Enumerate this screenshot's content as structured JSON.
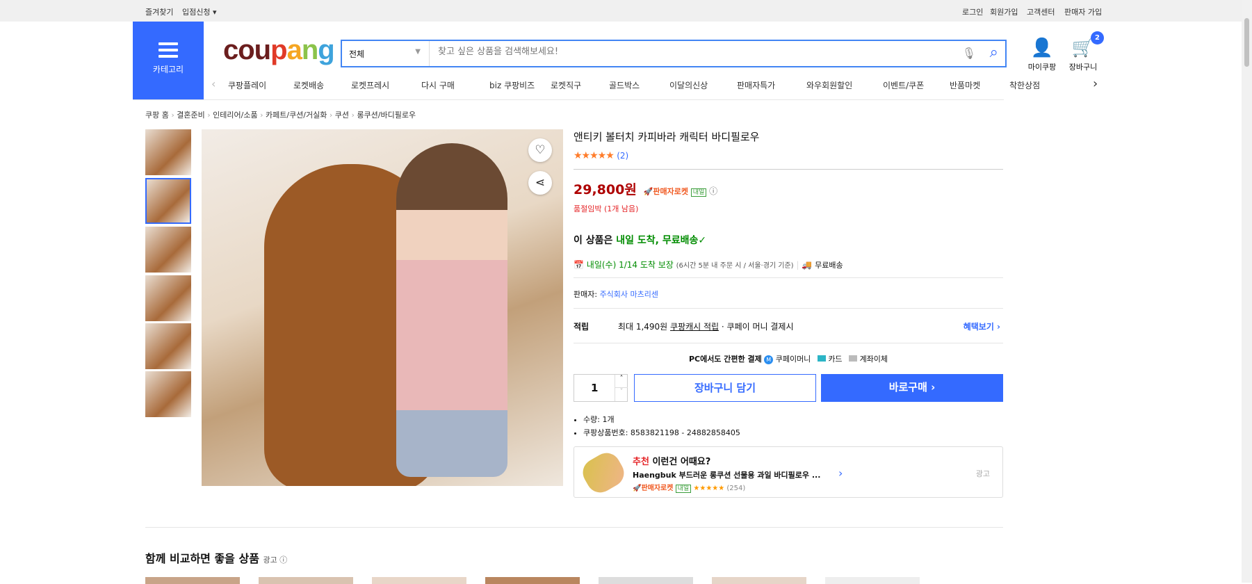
{
  "topbar": {
    "bookmark": "즐겨찾기",
    "seller_apply": "입점신청 ▾",
    "login": "로그인",
    "signup": "회원가입",
    "support": "고객센터",
    "seller_signup": "판매자 가입"
  },
  "header": {
    "category": "카테고리",
    "logo": "coupang",
    "search_category": "전체",
    "search_placeholder": "찾고 싶은 상품을 검색해보세요!",
    "my_coupang": "마이쿠팡",
    "cart": "장바구니",
    "cart_count": "2"
  },
  "nav": [
    "쿠팡플레이",
    "로켓배송",
    "로켓프레시",
    "다시 구매",
    "biz 쿠팡비즈",
    "로켓직구",
    "골드박스",
    "이달의신상",
    "판매자특가",
    "와우회원할인",
    "이벤트/쿠폰",
    "반품마켓",
    "착한상점"
  ],
  "breadcrumb": [
    "쿠팡 홈",
    "결혼준비",
    "인테리어/소품",
    "카페트/쿠션/거실화",
    "쿠션",
    "롱쿠션/바디필로우"
  ],
  "product": {
    "title": "앤티키 볼터치 카피바라 캐릭터 바디필로우",
    "rating_count": "(2)",
    "rating": 5,
    "price": "29,800원",
    "badge": "판매자로켓",
    "badge_tomorrow": "내일",
    "stock": "품절임박 (1개 남음)",
    "delivery_head": "이 상품은 ",
    "delivery_green": "내일 도착, 무료배송",
    "delivery_date": "내일(수) 1/14 도착 보장",
    "delivery_note": "(6시간 5분 내 주문 시 / 서울·경기 기준)",
    "free_shipping": "무료배송",
    "seller_label": "판매자: ",
    "seller": "주식회사 마츠리센",
    "reward_label": "적립",
    "reward_text1": "최대 1,490원 ",
    "reward_link": "쿠팡캐시 적립",
    "reward_text2": " · 쿠페이 머니 결제시",
    "benefit": "혜택보기 ›",
    "pay_title": "PC에서도 간편한 결제",
    "pay_methods": [
      "쿠페이머니",
      "카드",
      "계좌이체"
    ],
    "quantity": "1",
    "add_cart": "장바구니 담기",
    "buy_now": "바로구매 ›",
    "bullets": [
      "수량: 1개",
      "쿠팡상품번호: 8583821198 - 24882858405"
    ]
  },
  "recommend": {
    "label_red": "추천",
    "label": " 이런건 어때요?",
    "name": "Haengbuk 부드러운 롱쿠션 선물용 과일 바디필로우 ...",
    "badge": "판매자로켓",
    "tomorrow": "내일",
    "stars": "★★★★★",
    "rating": 4.5,
    "count": "(254)",
    "ad": "광고"
  },
  "compare": {
    "title": "함께 비교하면 좋을 상품",
    "ad": "광고 ⓘ"
  },
  "colors": {
    "brand": "#346aff",
    "price": "#ae0000",
    "green": "#008c00"
  }
}
